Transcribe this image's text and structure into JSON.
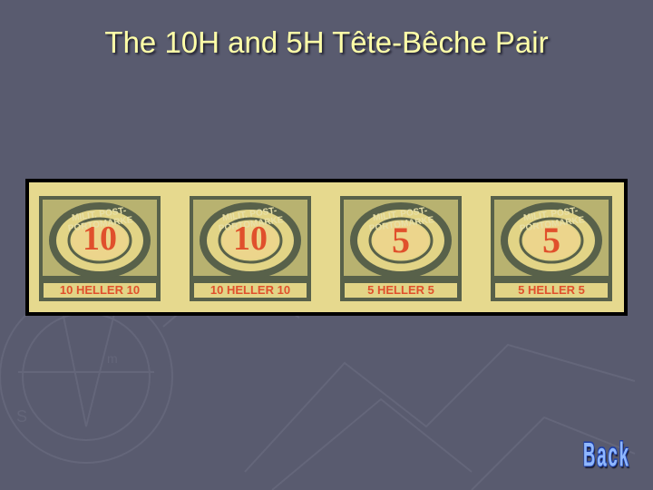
{
  "slide": {
    "title": "The 10H and 5H Tête-Bêche Pair"
  },
  "stamps": [
    {
      "inscription": "MILIT. POST-PORTOMARKE",
      "value": "10",
      "bottom_label": "10 HELLER 10"
    },
    {
      "inscription": "MILIT. POST-PORTOMARKE",
      "value": "10",
      "bottom_label": "10 HELLER 10"
    },
    {
      "inscription": "MILIT. POST-PORTOMARKE",
      "value": "5",
      "bottom_label": "5 HELLER 5"
    },
    {
      "inscription": "MILIT. POST-PORTOMARKE",
      "value": "5",
      "bottom_label": "5 HELLER 5"
    }
  ],
  "navigation": {
    "back_label": "Back"
  },
  "colors": {
    "background": "#595b6f",
    "title": "#ffffa8",
    "stamp_frame": "#58614a",
    "stamp_value": "#e0502c",
    "stamp_paper": "#e6d98e",
    "back_fill": "#8fb7ff",
    "back_outline": "#1d3fa8"
  }
}
